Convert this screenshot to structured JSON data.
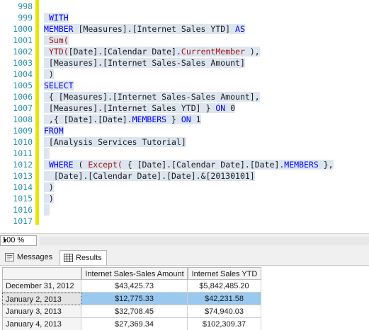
{
  "editor": {
    "lines": [
      {
        "n": "998",
        "sel": false,
        "tokens": []
      },
      {
        "n": "999",
        "sel": true,
        "tokens": [
          {
            "t": " ",
            "c": "pl"
          },
          {
            "t": "WITH",
            "c": "kw"
          }
        ]
      },
      {
        "n": "1000",
        "sel": true,
        "tokens": [
          {
            "t": "MEMBER",
            "c": "kw"
          },
          {
            "t": " [Measures].[Internet Sales YTD] ",
            "c": "pl"
          },
          {
            "t": "AS",
            "c": "kw"
          }
        ]
      },
      {
        "n": "1001",
        "sel": true,
        "tokens": [
          {
            "t": " ",
            "c": "pl"
          },
          {
            "t": "Sum(",
            "c": "fn"
          }
        ]
      },
      {
        "n": "1002",
        "sel": true,
        "tokens": [
          {
            "t": " ",
            "c": "pl"
          },
          {
            "t": "YTD(",
            "c": "fn"
          },
          {
            "t": "[Date].[Calendar Date].",
            "c": "pl"
          },
          {
            "t": "CurrentMember",
            "c": "fn"
          },
          {
            "t": " ),",
            "c": "pl"
          }
        ]
      },
      {
        "n": "1003",
        "sel": true,
        "tokens": [
          {
            "t": " [Measures].[Internet Sales-Sales Amount]",
            "c": "pl"
          }
        ]
      },
      {
        "n": "1004",
        "sel": true,
        "tokens": [
          {
            "t": " )",
            "c": "pl"
          }
        ]
      },
      {
        "n": "1005",
        "sel": true,
        "tokens": [
          {
            "t": "SELECT",
            "c": "kw"
          }
        ]
      },
      {
        "n": "1006",
        "sel": true,
        "tokens": [
          {
            "t": " { [Measures].[Internet Sales-Sales Amount],",
            "c": "pl"
          }
        ]
      },
      {
        "n": "1007",
        "sel": true,
        "tokens": [
          {
            "t": " [Measures].[Internet Sales YTD] } ",
            "c": "pl"
          },
          {
            "t": "ON",
            "c": "kw"
          },
          {
            "t": " 0",
            "c": "pl"
          }
        ]
      },
      {
        "n": "1008",
        "sel": true,
        "tokens": [
          {
            "t": " ,{ [Date].[Date].",
            "c": "pl"
          },
          {
            "t": "MEMBERS",
            "c": "kw"
          },
          {
            "t": " } ",
            "c": "pl"
          },
          {
            "t": "ON",
            "c": "kw"
          },
          {
            "t": " 1",
            "c": "pl"
          }
        ]
      },
      {
        "n": "1009",
        "sel": true,
        "tokens": [
          {
            "t": "FROM",
            "c": "kw"
          }
        ]
      },
      {
        "n": "1010",
        "sel": true,
        "tokens": [
          {
            "t": " [Analysis Services Tutorial]",
            "c": "pl"
          }
        ]
      },
      {
        "n": "1011",
        "sel": true,
        "tokens": [
          {
            "t": "",
            "c": "pl"
          }
        ]
      },
      {
        "n": "1012",
        "sel": true,
        "tokens": [
          {
            "t": " ",
            "c": "pl"
          },
          {
            "t": "WHERE",
            "c": "kw"
          },
          {
            "t": " ( ",
            "c": "pl"
          },
          {
            "t": "Except(",
            "c": "fn"
          },
          {
            "t": " { [Date].[Calendar Date].[Date].",
            "c": "pl"
          },
          {
            "t": "MEMBERS",
            "c": "kw"
          },
          {
            "t": " },",
            "c": "pl"
          }
        ]
      },
      {
        "n": "1013",
        "sel": true,
        "tokens": [
          {
            "t": "  [Date].[Calendar Date].[Date].&[20130101]",
            "c": "pl"
          }
        ]
      },
      {
        "n": "1014",
        "sel": true,
        "tokens": [
          {
            "t": " )",
            "c": "pl"
          }
        ]
      },
      {
        "n": "1015",
        "sel": true,
        "tokens": [
          {
            "t": " )",
            "c": "pl"
          }
        ]
      },
      {
        "n": "1016",
        "sel": true,
        "tokens": [
          {
            "t": "",
            "c": "pl"
          }
        ]
      },
      {
        "n": "1017",
        "sel": false,
        "tokens": []
      }
    ]
  },
  "zoom": {
    "value": "100 %"
  },
  "tabs": [
    {
      "label": "Messages",
      "icon": "messages-icon",
      "active": false
    },
    {
      "label": "Results",
      "icon": "grid-icon",
      "active": true
    }
  ],
  "results": {
    "columns": [
      "",
      "Internet Sales-Sales Amount",
      "Internet Sales YTD"
    ],
    "rows": [
      {
        "label": "December 31, 2012",
        "values": [
          "$43,425.73",
          "$5,842,485.20"
        ],
        "selected": false
      },
      {
        "label": "January 2, 2013",
        "values": [
          "$12,775.33",
          "$42,231.58"
        ],
        "selected": true
      },
      {
        "label": "January 3, 2013",
        "values": [
          "$32,708.45",
          "$74,940.03"
        ],
        "selected": false
      },
      {
        "label": "January 4, 2013",
        "values": [
          "$27,369.34",
          "$102,309.37"
        ],
        "selected": false
      }
    ]
  },
  "colors": {
    "keyword": "#0000ff",
    "function": "#a31515",
    "line_number": "#2b91af",
    "selection": "#dde6f0",
    "change_bar": "#e8e600",
    "selected_cell": "#99c9ef"
  }
}
